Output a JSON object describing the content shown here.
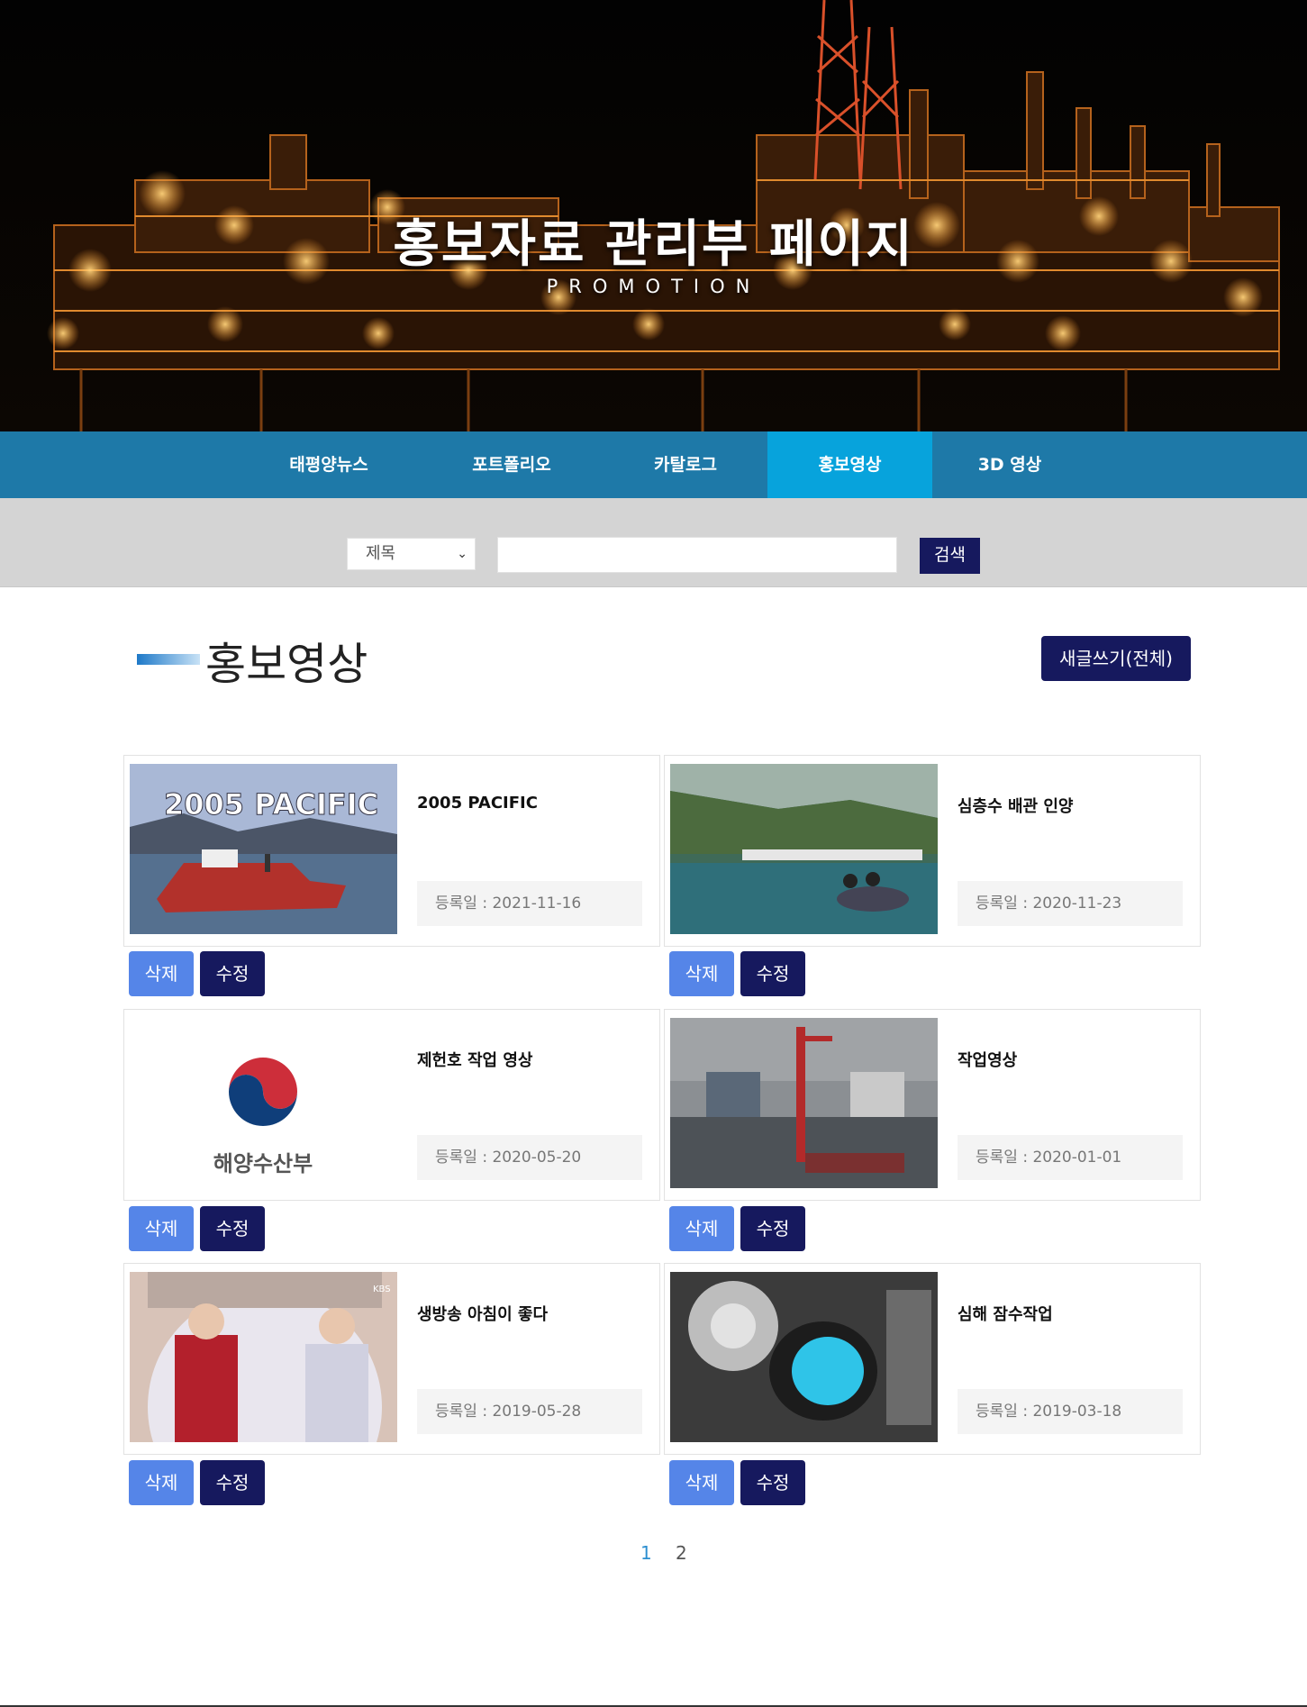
{
  "hero": {
    "title": "홍보자료 관리부 페이지",
    "subtitle": "PROMOTION"
  },
  "nav": {
    "items": [
      {
        "label": "태평양뉴스",
        "active": false
      },
      {
        "label": "포트폴리오",
        "active": false
      },
      {
        "label": "카탈로그",
        "active": false
      },
      {
        "label": "홍보영상",
        "active": true
      },
      {
        "label": "3D 영상",
        "active": false
      }
    ],
    "colors": {
      "bar": "#1e79a8",
      "active": "#07a3dc"
    }
  },
  "search": {
    "select_value": "제목",
    "input_value": "",
    "button_label": "검색"
  },
  "section": {
    "title": "홍보영상",
    "write_button": "새글쓰기(전체)"
  },
  "cards": [
    {
      "title": "2005 PACIFIC",
      "date": "등록일 : 2021-11-16",
      "delete_label": "삭제",
      "edit_label": "수정",
      "thumb_text": "2005 PACIFIC"
    },
    {
      "title": "심층수 배관 인양",
      "date": "등록일 : 2020-11-23",
      "delete_label": "삭제",
      "edit_label": "수정"
    },
    {
      "title": "제헌호 작업 영상",
      "date": "등록일 : 2020-05-20",
      "delete_label": "삭제",
      "edit_label": "수정",
      "thumb_text": "해양수산부"
    },
    {
      "title": "작업영상",
      "date": "등록일 : 2020-01-01",
      "delete_label": "삭제",
      "edit_label": "수정"
    },
    {
      "title": "생방송 아침이 좋다",
      "date": "등록일 : 2019-05-28",
      "delete_label": "삭제",
      "edit_label": "수정",
      "thumb_text": "KBS"
    },
    {
      "title": "심해 잠수작업",
      "date": "등록일 : 2019-03-18",
      "delete_label": "삭제",
      "edit_label": "수정"
    }
  ],
  "pagination": {
    "pages": [
      "1",
      "2"
    ],
    "current": "1"
  },
  "colors": {
    "primary_dark": "#16195e",
    "delete": "#5585e8",
    "accent_link": "#2d8fd0"
  }
}
